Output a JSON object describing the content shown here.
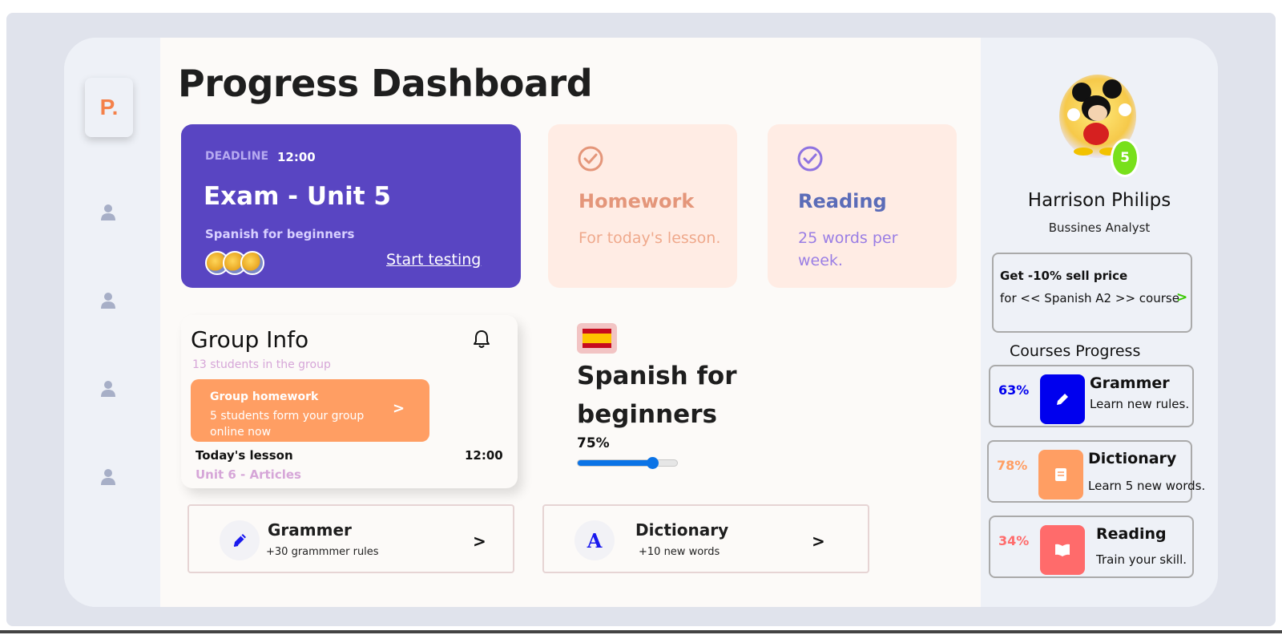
{
  "sidebar": {
    "logo": "P.",
    "items": [
      {
        "icon": "user-icon"
      },
      {
        "icon": "user-icon"
      },
      {
        "icon": "user-icon"
      },
      {
        "icon": "user-icon"
      }
    ]
  },
  "main": {
    "title": "Progress Dashboard",
    "exam": {
      "deadline_label": "DEADLINE",
      "deadline_time": "12:00",
      "title": "Exam - Unit 5",
      "subtitle": "Spanish for beginners",
      "link": "Start testing"
    },
    "tasks": [
      {
        "title": "Homework",
        "desc": "For today's lesson.",
        "color": "#e4967a",
        "desc_color": "#efa98c"
      },
      {
        "title": "Reading",
        "desc": "25 words per week.",
        "color": "#5b6cb8",
        "desc_color": "#9a7ee4"
      }
    ],
    "group": {
      "title": "Group Info",
      "subtitle": "13 students in the group",
      "homework_title": "Group homework",
      "homework_desc": "5 students form your group online now",
      "homework_arrow": ">",
      "today_label": "Today's lesson",
      "today_time": "12:00",
      "today_unit": "Unit 6 - Articles"
    },
    "course": {
      "title": "Spanish for beginners",
      "progress_label": "75%",
      "progress": 0.75
    },
    "shortcuts": [
      {
        "title": "Grammer",
        "subtitle": "+30 grammmer rules",
        "arrow": ">",
        "icon": "pencil-icon"
      },
      {
        "title": "Dictionary",
        "subtitle": "+10 new words",
        "arrow": ">",
        "icon": "letter-a-icon",
        "glyph": "A"
      }
    ]
  },
  "profile": {
    "name": "Harrison Philips",
    "role": "Bussines Analyst",
    "level": "5",
    "promo_title": "Get -10% sell price",
    "promo_desc": "for << Spanish A2 >> course",
    "promo_arrow": ">",
    "courses_heading": "Courses Progress",
    "courses": [
      {
        "pct": "63%",
        "title": "Grammer",
        "desc": "Learn new rules.",
        "color": "#0000ee",
        "icon_bg": "#0000ee",
        "icon": "pencil-icon"
      },
      {
        "pct": "78%",
        "title": "Dictionary",
        "desc": "Learn 5 new words.",
        "color": "#ff9e63",
        "icon_bg": "#ff9e63",
        "icon": "book-icon"
      },
      {
        "pct": "34%",
        "title": "Reading",
        "desc": "Train your skill.",
        "color": "#ff6b6b",
        "icon_bg": "#ff6b6b",
        "icon": "open-book-icon"
      }
    ]
  }
}
